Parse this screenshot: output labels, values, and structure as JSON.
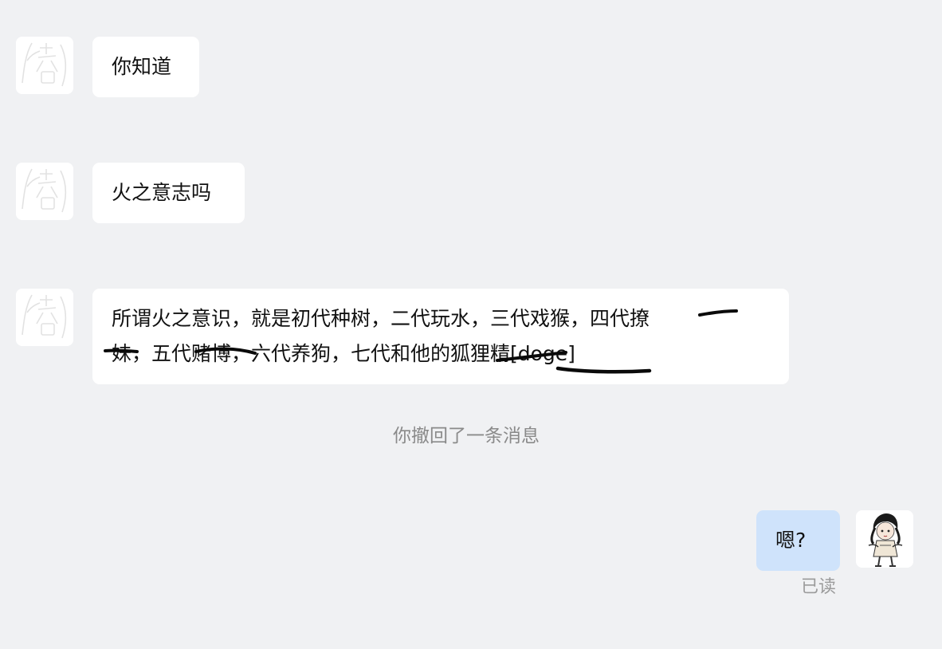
{
  "messages": [
    {
      "sender": "contact",
      "text": "你知道"
    },
    {
      "sender": "contact",
      "text": "火之意志吗"
    },
    {
      "sender": "contact",
      "line1": "所谓火之意识，就是初代种树，二代玩水，三代戏猴，四代撩",
      "line2": "妹，五代赌博，六代养狗，七代和他的狐狸精[doge]"
    },
    {
      "sender": "me",
      "text": "嗯?"
    }
  ],
  "system_notice": "你撤回了一条消息",
  "read_status": "已读",
  "colors": {
    "background": "#f0f1f3",
    "incoming_bubble": "#ffffff",
    "outgoing_bubble": "#cfe3fb",
    "ink_marks": "#0a0a0a"
  },
  "icons": {
    "contact_avatar": "seal-stamp-avatar",
    "my_avatar": "anime-character-avatar"
  }
}
